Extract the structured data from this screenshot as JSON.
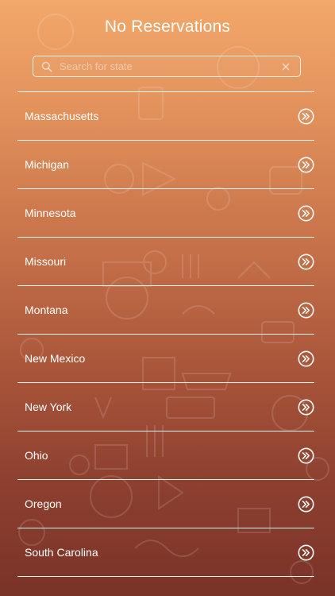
{
  "app": {
    "title": "No Reservations"
  },
  "search": {
    "placeholder": "Search for state",
    "value": "",
    "icon": "search-icon",
    "clear_icon": "clear-icon"
  },
  "states": [
    {
      "label": "Massachusetts"
    },
    {
      "label": "Michigan"
    },
    {
      "label": "Minnesota"
    },
    {
      "label": "Missouri"
    },
    {
      "label": "Montana"
    },
    {
      "label": "New Mexico"
    },
    {
      "label": "New York"
    },
    {
      "label": "Ohio"
    },
    {
      "label": "Oregon"
    },
    {
      "label": "South Carolina"
    }
  ],
  "row_icon": "double-chevron-right-icon",
  "colors": {
    "gradient_top": "#f2a86a",
    "gradient_bottom": "#7a3328",
    "text": "#ffffff"
  }
}
